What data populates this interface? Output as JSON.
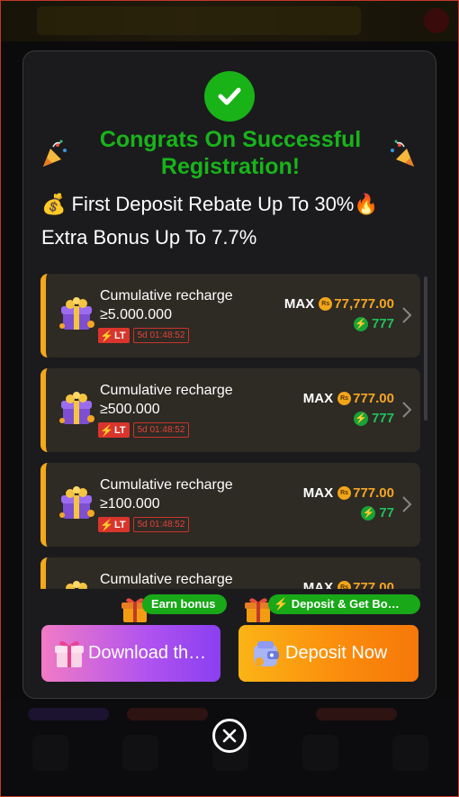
{
  "dialog": {
    "title": "Congrats On Successful Registration!",
    "promo_line_1": "💰 First Deposit Rebate Up To 30%🔥",
    "promo_line_2": "Extra Bonus Up To 7.7%"
  },
  "rewards": [
    {
      "label": "Cumulative recharge ≥5.000.000",
      "tag": "LT",
      "timer": "5d 01:48:52",
      "max_label": "MAX",
      "currency_icon": "Rs",
      "amount": "77,777.00",
      "bonus": "777"
    },
    {
      "label": "Cumulative recharge ≥500.000",
      "tag": "LT",
      "timer": "5d 01:48:52",
      "max_label": "MAX",
      "currency_icon": "Rs",
      "amount": "777.00",
      "bonus": "777"
    },
    {
      "label": "Cumulative recharge ≥100.000",
      "tag": "LT",
      "timer": "5d 01:48:52",
      "max_label": "MAX",
      "currency_icon": "Rs",
      "amount": "777.00",
      "bonus": "77"
    },
    {
      "label": "Cumulative recharge",
      "tag": "",
      "timer": "",
      "max_label": "MAX",
      "currency_icon": "Rs",
      "amount": "777.00",
      "bonus": ""
    }
  ],
  "actions": {
    "download": {
      "badge": "Earn bonus",
      "label": "Download th…"
    },
    "deposit": {
      "badge": "⚡ Deposit & Get Bo…",
      "label": "Deposit Now"
    }
  },
  "colors": {
    "success_green": "#18b41a",
    "accent_orange": "#f4a81b",
    "card_bg": "#2e2a24",
    "modal_bg": "#1b1b1e"
  },
  "icons": {
    "header": "check-circle-icon",
    "decor": "party-popper-icon",
    "reward": "gift-box-icon",
    "close": "close-circle-icon"
  }
}
